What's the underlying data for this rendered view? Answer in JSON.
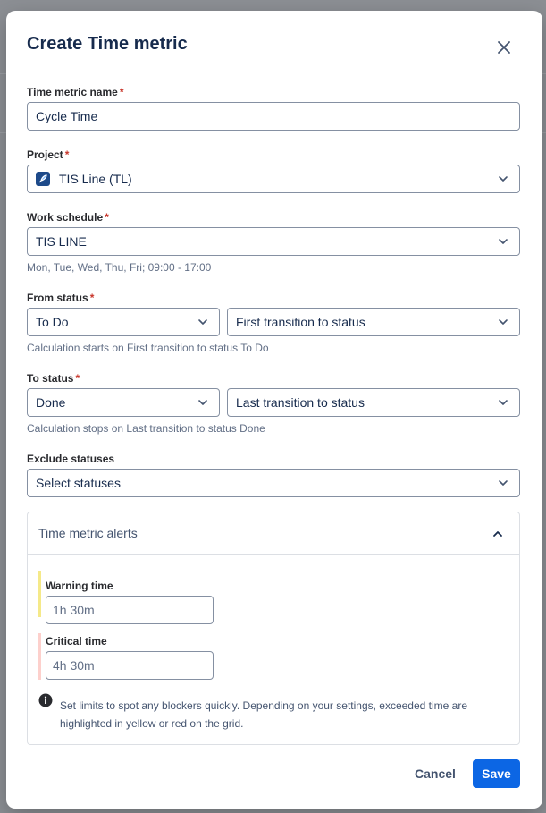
{
  "dialog": {
    "title": "Create Time metric"
  },
  "fields": {
    "name": {
      "label": "Time metric name",
      "value": "Cycle Time"
    },
    "project": {
      "label": "Project",
      "value": "TIS Line (TL)"
    },
    "schedule": {
      "label": "Work schedule",
      "value": "TIS LINE",
      "helper": "Mon, Tue, Wed, Thu, Fri; 09:00 - 17:00"
    },
    "from_status": {
      "label": "From status",
      "status": "To Do",
      "transition": "First transition to status",
      "helper": "Calculation starts on First transition to status To Do"
    },
    "to_status": {
      "label": "To status",
      "status": "Done",
      "transition": "Last transition to status",
      "helper": "Calculation stops on Last transition to status Done"
    },
    "exclude": {
      "label": "Exclude statuses",
      "value": "Select statuses"
    }
  },
  "alerts": {
    "title": "Time metric alerts",
    "warning": {
      "label": "Warning time",
      "placeholder": "1h 30m",
      "color": "#f5e989"
    },
    "critical": {
      "label": "Critical time",
      "placeholder": "4h 30m",
      "color": "#fdd0cc"
    },
    "info": "Set limits to spot any blockers quickly. Depending on your settings, exceeded time are highlighted in yellow or red on the grid."
  },
  "actions": {
    "cancel": "Cancel",
    "save": "Save"
  },
  "colors": {
    "primary": "#0c66e4",
    "required": "#c9372c"
  },
  "required_marker": "*"
}
